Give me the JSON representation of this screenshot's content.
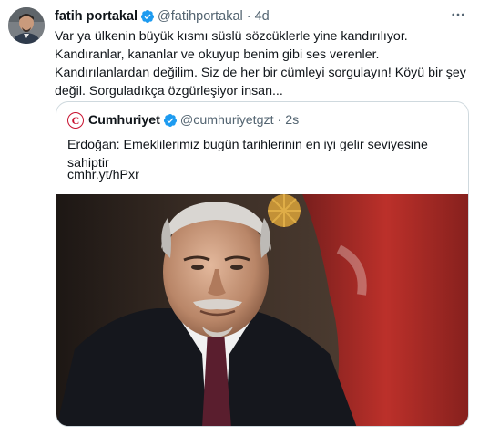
{
  "tweet": {
    "display_name": "fatih portakal",
    "handle": "@fatihportakal",
    "separator": "·",
    "time": "4d",
    "text": "Var ya ülkenin büyük kısmı süslü sözcüklerle yine kandırılıyor. Kandıranlar, kananlar ve okuyup benim gibi ses verenler. Kandırılanlardan değilim. Siz de her bir cümleyi sorgulayın! Köyü bir şey değil. Sorguladıkça özgürleşiyor insan...",
    "verified": true
  },
  "quote": {
    "logo_letter": "C",
    "display_name": "Cumhuriyet",
    "handle": "@cumhuriyetgzt",
    "separator": "·",
    "time": "2s",
    "text": "Erdoğan: Emeklilerimiz bugün tarihlerinin en iyi gelir seviyesine sahiptir",
    "link": "cmhr.yt/hPxr",
    "verified": true
  },
  "colors": {
    "verified": "#1d9bf0",
    "secondary_text": "#536471",
    "border": "#cfd9de",
    "brand_red": "#c8102e"
  },
  "icons": {
    "verified": "verified-badge-icon",
    "more": "more-options-icon"
  }
}
